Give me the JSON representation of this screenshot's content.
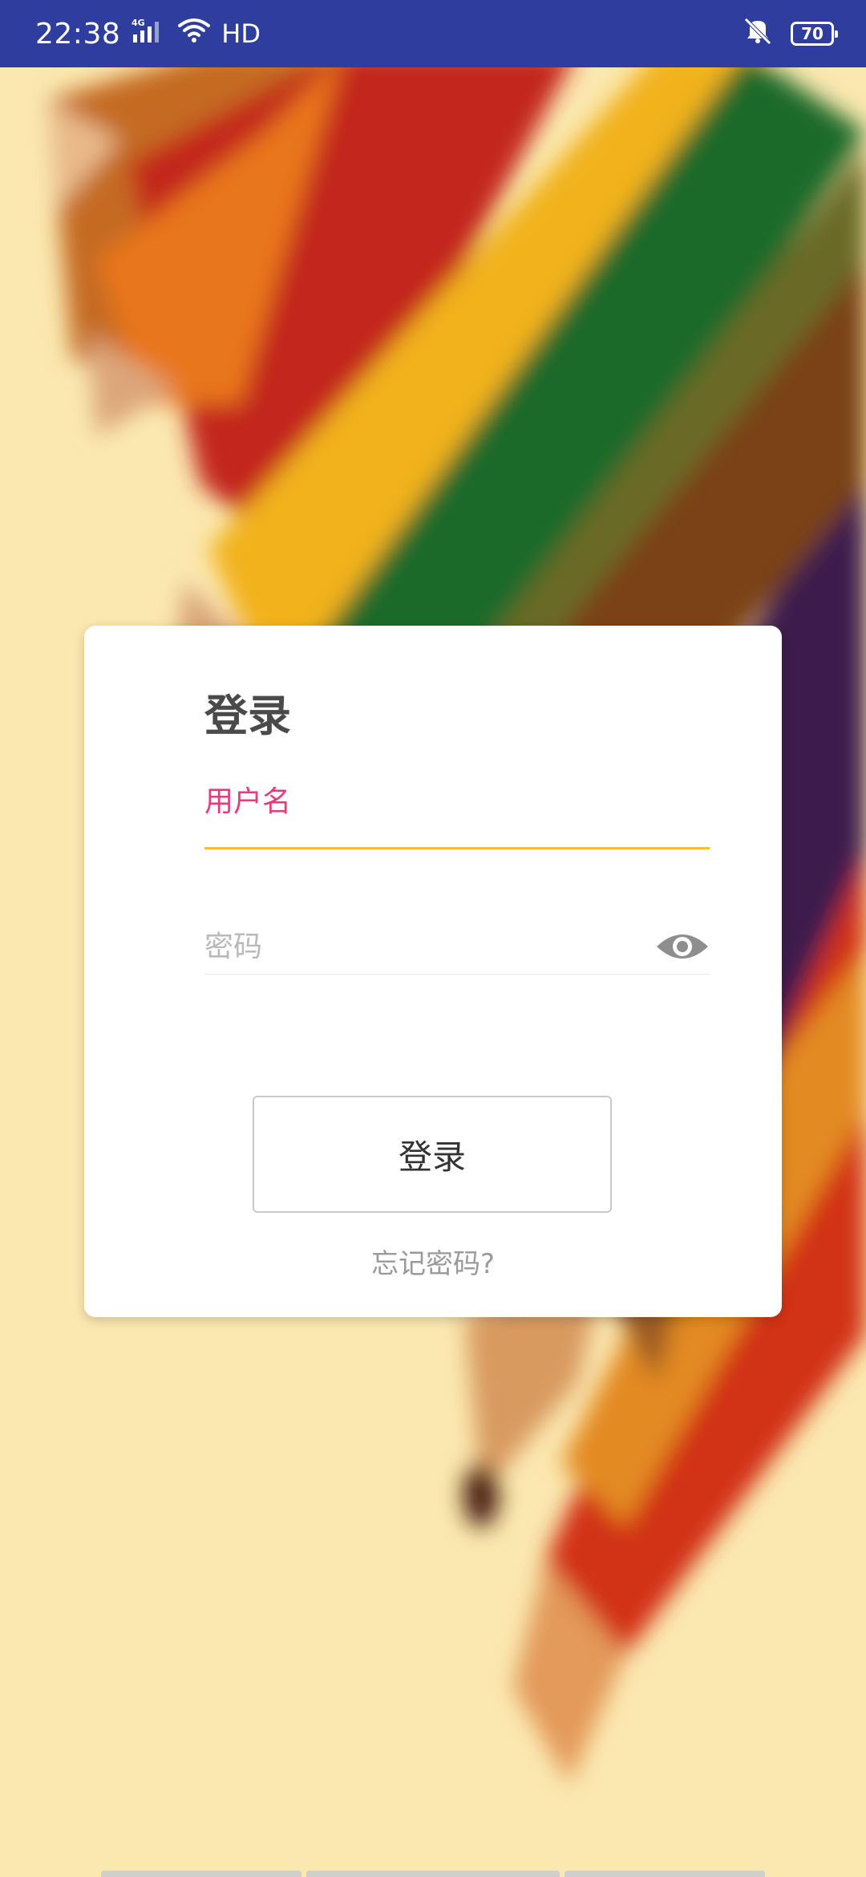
{
  "status_bar": {
    "time": "22:38",
    "network": "4G",
    "hd": "HD",
    "battery": "70"
  },
  "login": {
    "title": "登录",
    "username_label": "用户名",
    "username_value": "",
    "password_placeholder": "密码",
    "login_button": "登录",
    "forgot_link": "忘记密码?"
  },
  "colors": {
    "status_bar": "#2f3e9e",
    "accent_label": "#e63a7a",
    "focus_underline": "#f6c02e",
    "background": "#fbe8b0"
  },
  "icons": {
    "password_toggle": "eye-icon"
  }
}
